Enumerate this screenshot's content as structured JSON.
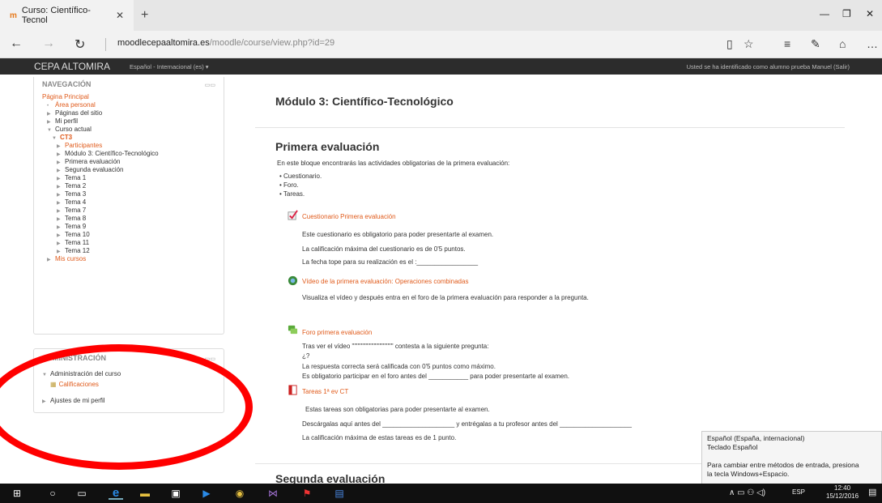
{
  "browser": {
    "tab_title": "Curso: Científico-Tecnol",
    "favicon": "m",
    "new_tab": "+",
    "url_domain": "moodlecepaaltomira.es",
    "url_path": "/moodle/course/view.php?id=29"
  },
  "moodle": {
    "brand": "CEPA ALTOMIRA",
    "language": "Español - Internacional (es) ▾",
    "login_info": "Usted se ha identificado como alumno prueba Manuel (Salir)"
  },
  "navigation": {
    "title": "NAVEGACIÓN",
    "items": [
      {
        "label": "Página Principal",
        "link": true,
        "indent": 0,
        "arrow": ""
      },
      {
        "label": "Área personal",
        "link": true,
        "indent": 1,
        "arrow": "•"
      },
      {
        "label": "Páginas del sitio",
        "link": false,
        "indent": 1,
        "arrow": "▶"
      },
      {
        "label": "Mi perfil",
        "link": false,
        "indent": 1,
        "arrow": "▶"
      },
      {
        "label": "Curso actual",
        "link": false,
        "indent": 1,
        "arrow": "▼"
      },
      {
        "label": "CT3",
        "link": true,
        "indent": 2,
        "arrow": "▼",
        "bold": true
      },
      {
        "label": "Participantes",
        "link": true,
        "indent": 3,
        "arrow": "▶"
      },
      {
        "label": "Módulo 3: Científico-Tecnológico",
        "link": false,
        "indent": 3,
        "arrow": "▶"
      },
      {
        "label": "Primera evaluación",
        "link": false,
        "indent": 3,
        "arrow": "▶"
      },
      {
        "label": "Segunda evaluación",
        "link": false,
        "indent": 3,
        "arrow": "▶"
      },
      {
        "label": "Tema 1",
        "link": false,
        "indent": 3,
        "arrow": "▶"
      },
      {
        "label": "Tema 2",
        "link": false,
        "indent": 3,
        "arrow": "▶"
      },
      {
        "label": "Tema 3",
        "link": false,
        "indent": 3,
        "arrow": "▶"
      },
      {
        "label": "Tema 4",
        "link": false,
        "indent": 3,
        "arrow": "▶"
      },
      {
        "label": "Tema 7",
        "link": false,
        "indent": 3,
        "arrow": "▶"
      },
      {
        "label": "Tema 8",
        "link": false,
        "indent": 3,
        "arrow": "▶"
      },
      {
        "label": "Tema 9",
        "link": false,
        "indent": 3,
        "arrow": "▶"
      },
      {
        "label": "Tema 10",
        "link": false,
        "indent": 3,
        "arrow": "▶"
      },
      {
        "label": "Tema 11",
        "link": false,
        "indent": 3,
        "arrow": "▶"
      },
      {
        "label": "Tema 12",
        "link": false,
        "indent": 3,
        "arrow": "▶"
      },
      {
        "label": "Mis cursos",
        "link": true,
        "indent": 1,
        "arrow": "▶"
      }
    ]
  },
  "administration": {
    "title": "ADMINISTRACIÓN",
    "course_admin": "Administración del curso",
    "grades": "Calificaciones",
    "profile_settings": "Ajustes de mi perfil"
  },
  "main": {
    "course_title": "Módulo 3: Científico-Tecnológico",
    "section1": {
      "title": "Primera evaluación",
      "intro": "En este bloque encontrarás las actividades obligatorias de la primera evaluación:",
      "bullets": [
        "Cuestionario.",
        "Foro.",
        "Tareas."
      ],
      "quiz_link": "Cuestionario Primera evaluación",
      "quiz_lines": [
        "Este cuestionario es obligatorio para poder presentarte al examen.",
        "La calificación máxima del cuestionario es de 0'5 puntos.",
        "La fecha tope para su realización es el :_________________"
      ],
      "video_link": "Vídeo de la primera evaluación: Operaciones combinadas",
      "video_line": "Visualiza el vídeo y después entra en el foro de la primera evaluación para responder a la pregunta.",
      "forum_link": "Foro primera evaluación",
      "forum_lines": [
        "Tras ver el vídeo \"\"\"\"\"\"\"\"\"\"\"\"\"\"\"\"\"\" contesta a la siguiente pregunta:",
        "¿?",
        "La respuesta correcta será calificada con 0'5 puntos como máximo.",
        "Es obligatorio participar en el foro antes del ___________ para poder presentarte al examen."
      ],
      "tasks_link": "Tareas 1ª ev CT",
      "tasks_lines": [
        "Estas tareas son obligatorias para poder presentarte al examen.",
        "Descárgalas aquí antes del ____________________ y entrégalas a tu profesor antes del ____________________",
        "La calificación máxima de estas tareas es de 1 punto."
      ]
    },
    "section2_title": "Segunda evaluación"
  },
  "ime_tooltip": {
    "line1": "Español (España, internacional)",
    "line2": "Teclado Español",
    "line3": "Para cambiar entre métodos de entrada, presiona",
    "line4": "la tecla Windows+Espacio."
  },
  "taskbar": {
    "lang": "ESP",
    "time": "12:40",
    "date": "15/12/2016"
  },
  "colors": {
    "link": "#e05a1a",
    "navbar": "#2c2c2c",
    "annotation": "#ff0000"
  }
}
